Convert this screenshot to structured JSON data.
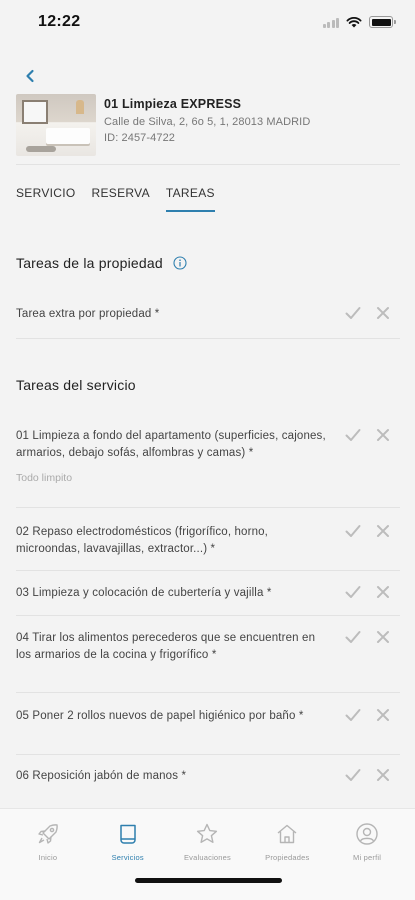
{
  "status_bar": {
    "time": "12:22"
  },
  "property": {
    "title": "01 Limpieza EXPRESS",
    "address": "Calle de Silva, 2, 6o 5, 1, 28013 MADRID",
    "id": "ID: 2457-4722"
  },
  "tabs": [
    {
      "label": "SERVICIO"
    },
    {
      "label": "RESERVA"
    },
    {
      "label": "TAREAS"
    }
  ],
  "active_tab": "TAREAS",
  "property_tasks": {
    "title": "Tareas de la propiedad",
    "items": [
      {
        "text": "Tarea extra por propiedad *"
      }
    ]
  },
  "service_tasks": {
    "title": "Tareas del servicio",
    "items": [
      {
        "text": "01 Limpieza a fondo del apartamento (superficies, cajones, armarios, debajo sofás, alfombras y camas) *",
        "note": "Todo limpito"
      },
      {
        "text": "02 Repaso electrodomésticos (frigorífico, horno, microondas, lavavajillas, extractor...) *"
      },
      {
        "text": "03 Limpieza y colocación de cubertería y vajilla *"
      },
      {
        "text": "04 Tirar los alimentos perecederos que se encuentren en los armarios de la cocina y frigorífico *"
      },
      {
        "text": "05 Poner 2 rollos nuevos de papel higiénico por baño *"
      },
      {
        "text": "06 Reposición jabón de manos *"
      }
    ]
  },
  "bottom_nav": [
    {
      "label": "Inicio",
      "icon": "rocket-icon"
    },
    {
      "label": "Servicios",
      "icon": "document-icon"
    },
    {
      "label": "Evaluaciones",
      "icon": "star-icon"
    },
    {
      "label": "Propiedades",
      "icon": "house-icon"
    },
    {
      "label": "Mi perfil",
      "icon": "user-icon"
    }
  ],
  "colors": {
    "accent": "#2e7fae",
    "background": "#f3f3f3",
    "icon_inactive": "#b5b5b5"
  }
}
